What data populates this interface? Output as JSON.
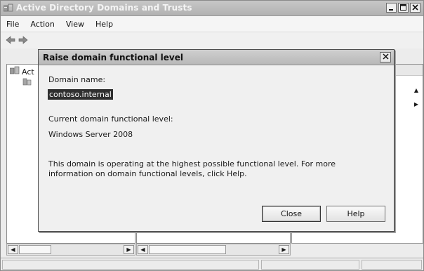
{
  "main_window": {
    "title": "Active Directory Domains and Trusts",
    "menu": [
      "File",
      "Action",
      "View",
      "Help"
    ],
    "tree": {
      "root_label": "Act"
    }
  },
  "dialog": {
    "title": "Raise domain functional level",
    "domain_name_label": "Domain name:",
    "domain_name_value": "contoso.internal",
    "current_level_label": "Current domain functional level:",
    "current_level_value": "Windows Server 2008",
    "info_text": "This domain is operating at the highest possible functional level. For more information on domain functional levels, click Help.",
    "close_label": "Close",
    "help_label": "Help"
  },
  "icons": {
    "app": "ad-domains-trusts-icon",
    "back": "back-arrow-icon",
    "forward": "forward-arrow-icon",
    "close": "close-icon",
    "minimize": "minimize-icon",
    "maximize": "maximize-icon"
  }
}
